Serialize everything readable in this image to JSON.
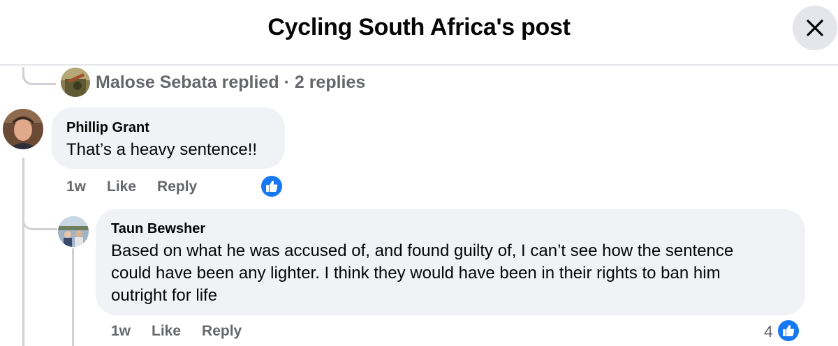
{
  "header": {
    "title": "Cycling South Africa's post"
  },
  "replied": {
    "name": "Malose Sebata replied",
    "sep": "·",
    "count": "2 replies"
  },
  "comments": [
    {
      "author": "Phillip Grant",
      "text": "That’s a heavy sentence!!",
      "time": "1w",
      "like_label": "Like",
      "reply_label": "Reply"
    },
    {
      "author": "Taun Bewsher",
      "lines": [
        "Based on what he was accused of, and found guilty of, I can’t see how the sentence",
        "could have been any lighter. I think they would have been in their rights to ban him",
        "outright for life"
      ],
      "time": "1w",
      "like_label": "Like",
      "reply_label": "Reply",
      "reaction_count": "4"
    }
  ],
  "colors": {
    "accent": "#1877f2",
    "bubble": "#f0f2f5",
    "secondary_text": "#65676b"
  },
  "icons": {
    "close": "close-icon",
    "like": "like-thumb-icon"
  }
}
